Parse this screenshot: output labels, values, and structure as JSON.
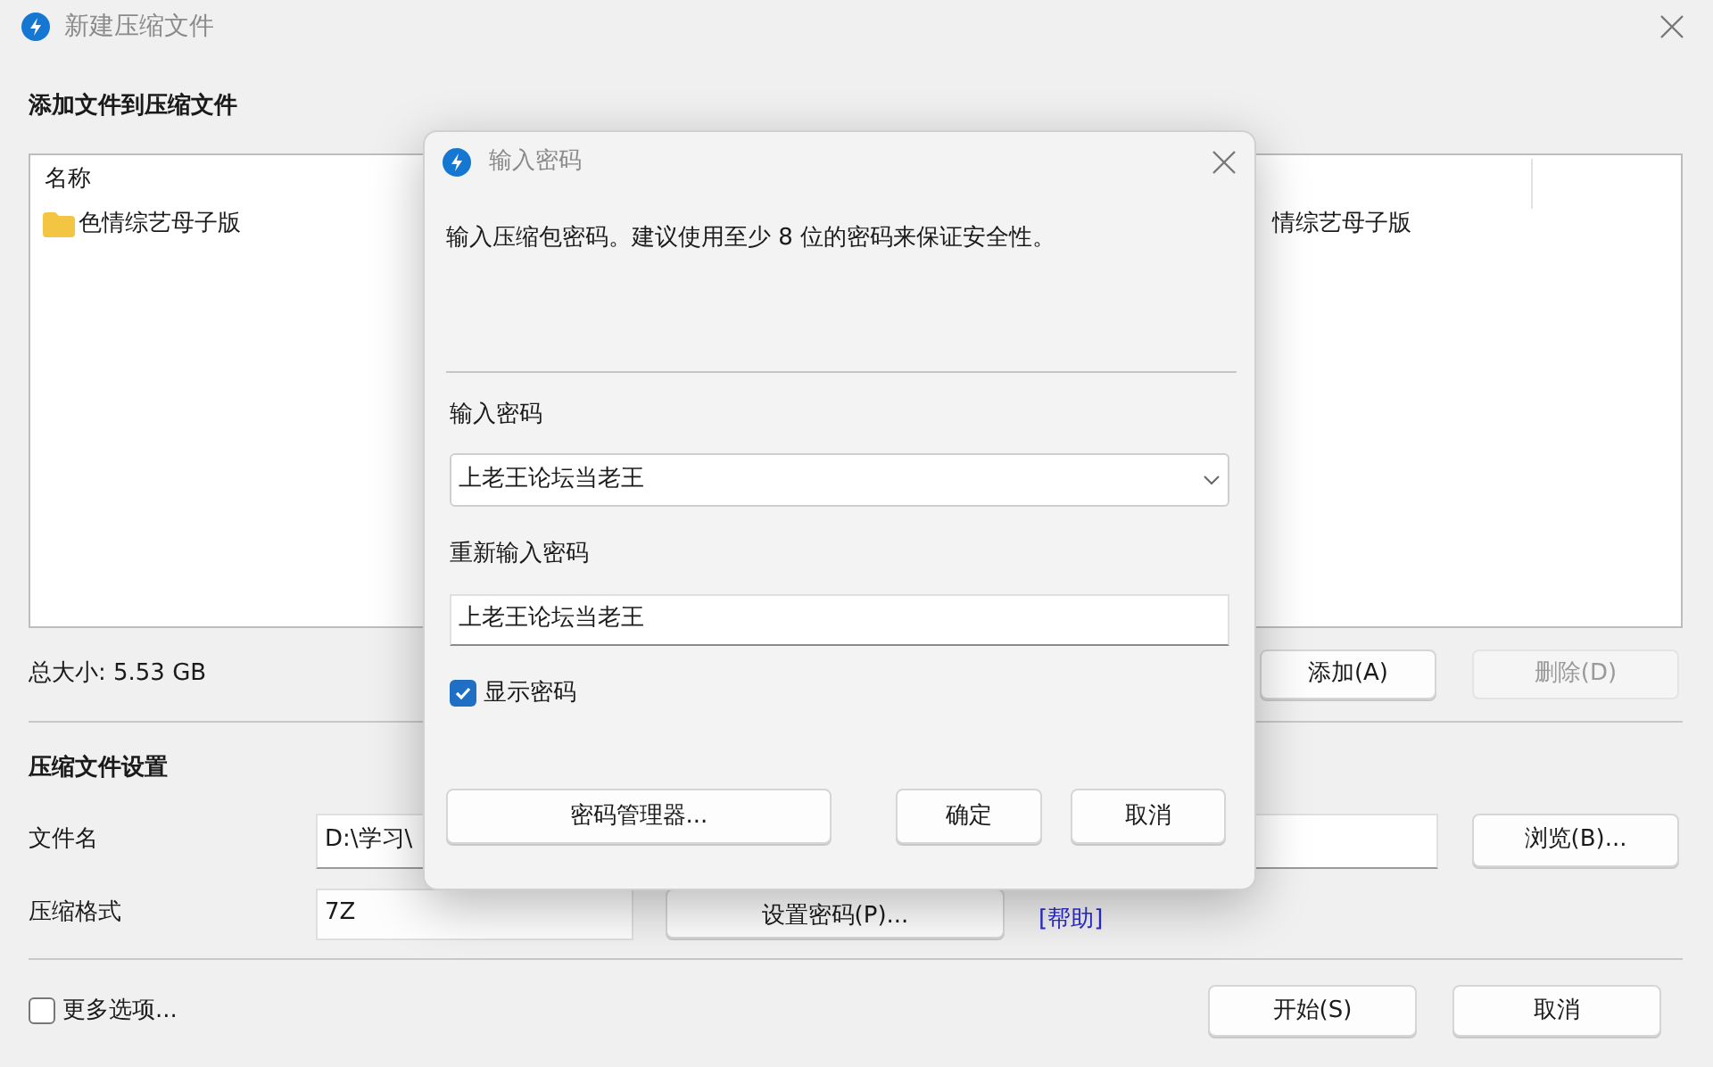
{
  "window": {
    "title": "新建压缩文件"
  },
  "files_section": {
    "heading": "添加文件到压缩文件",
    "columns": [
      "名称"
    ],
    "rows": [
      {
        "name": "色情综艺母子版",
        "column_2": "情综艺母子版"
      }
    ]
  },
  "total_size": "总大小: 5.53 GB",
  "file_buttons": [
    {
      "label": "添加(A)",
      "disabled": false
    },
    {
      "label": "删除(D)",
      "disabled": true
    }
  ],
  "settings": {
    "heading": "压缩文件设置",
    "filename_label": "文件名",
    "filename_value": "D:\\学习\\",
    "browse_button": "浏览(B)...",
    "format_label": "压缩格式",
    "format_value": "7Z",
    "password_button": "设置密码(P)...",
    "help_link": "[帮助]"
  },
  "more_options": {
    "label": "更多选项...",
    "checked": false
  },
  "buttons": [
    "开始(S)",
    "取消"
  ],
  "password_dialog": {
    "title": "输入密码",
    "message": "输入压缩包密码。建议使用至少 8 位的密码来保证安全性。",
    "password_label": "输入密码",
    "password_value": "上老王论坛当老王",
    "confirm_label": "重新输入密码",
    "confirm_value": "上老王论坛当老王",
    "show_password": {
      "label": "显示密码",
      "checked": true
    },
    "buttons": [
      "密码管理器...",
      "确定",
      "取消"
    ]
  }
}
